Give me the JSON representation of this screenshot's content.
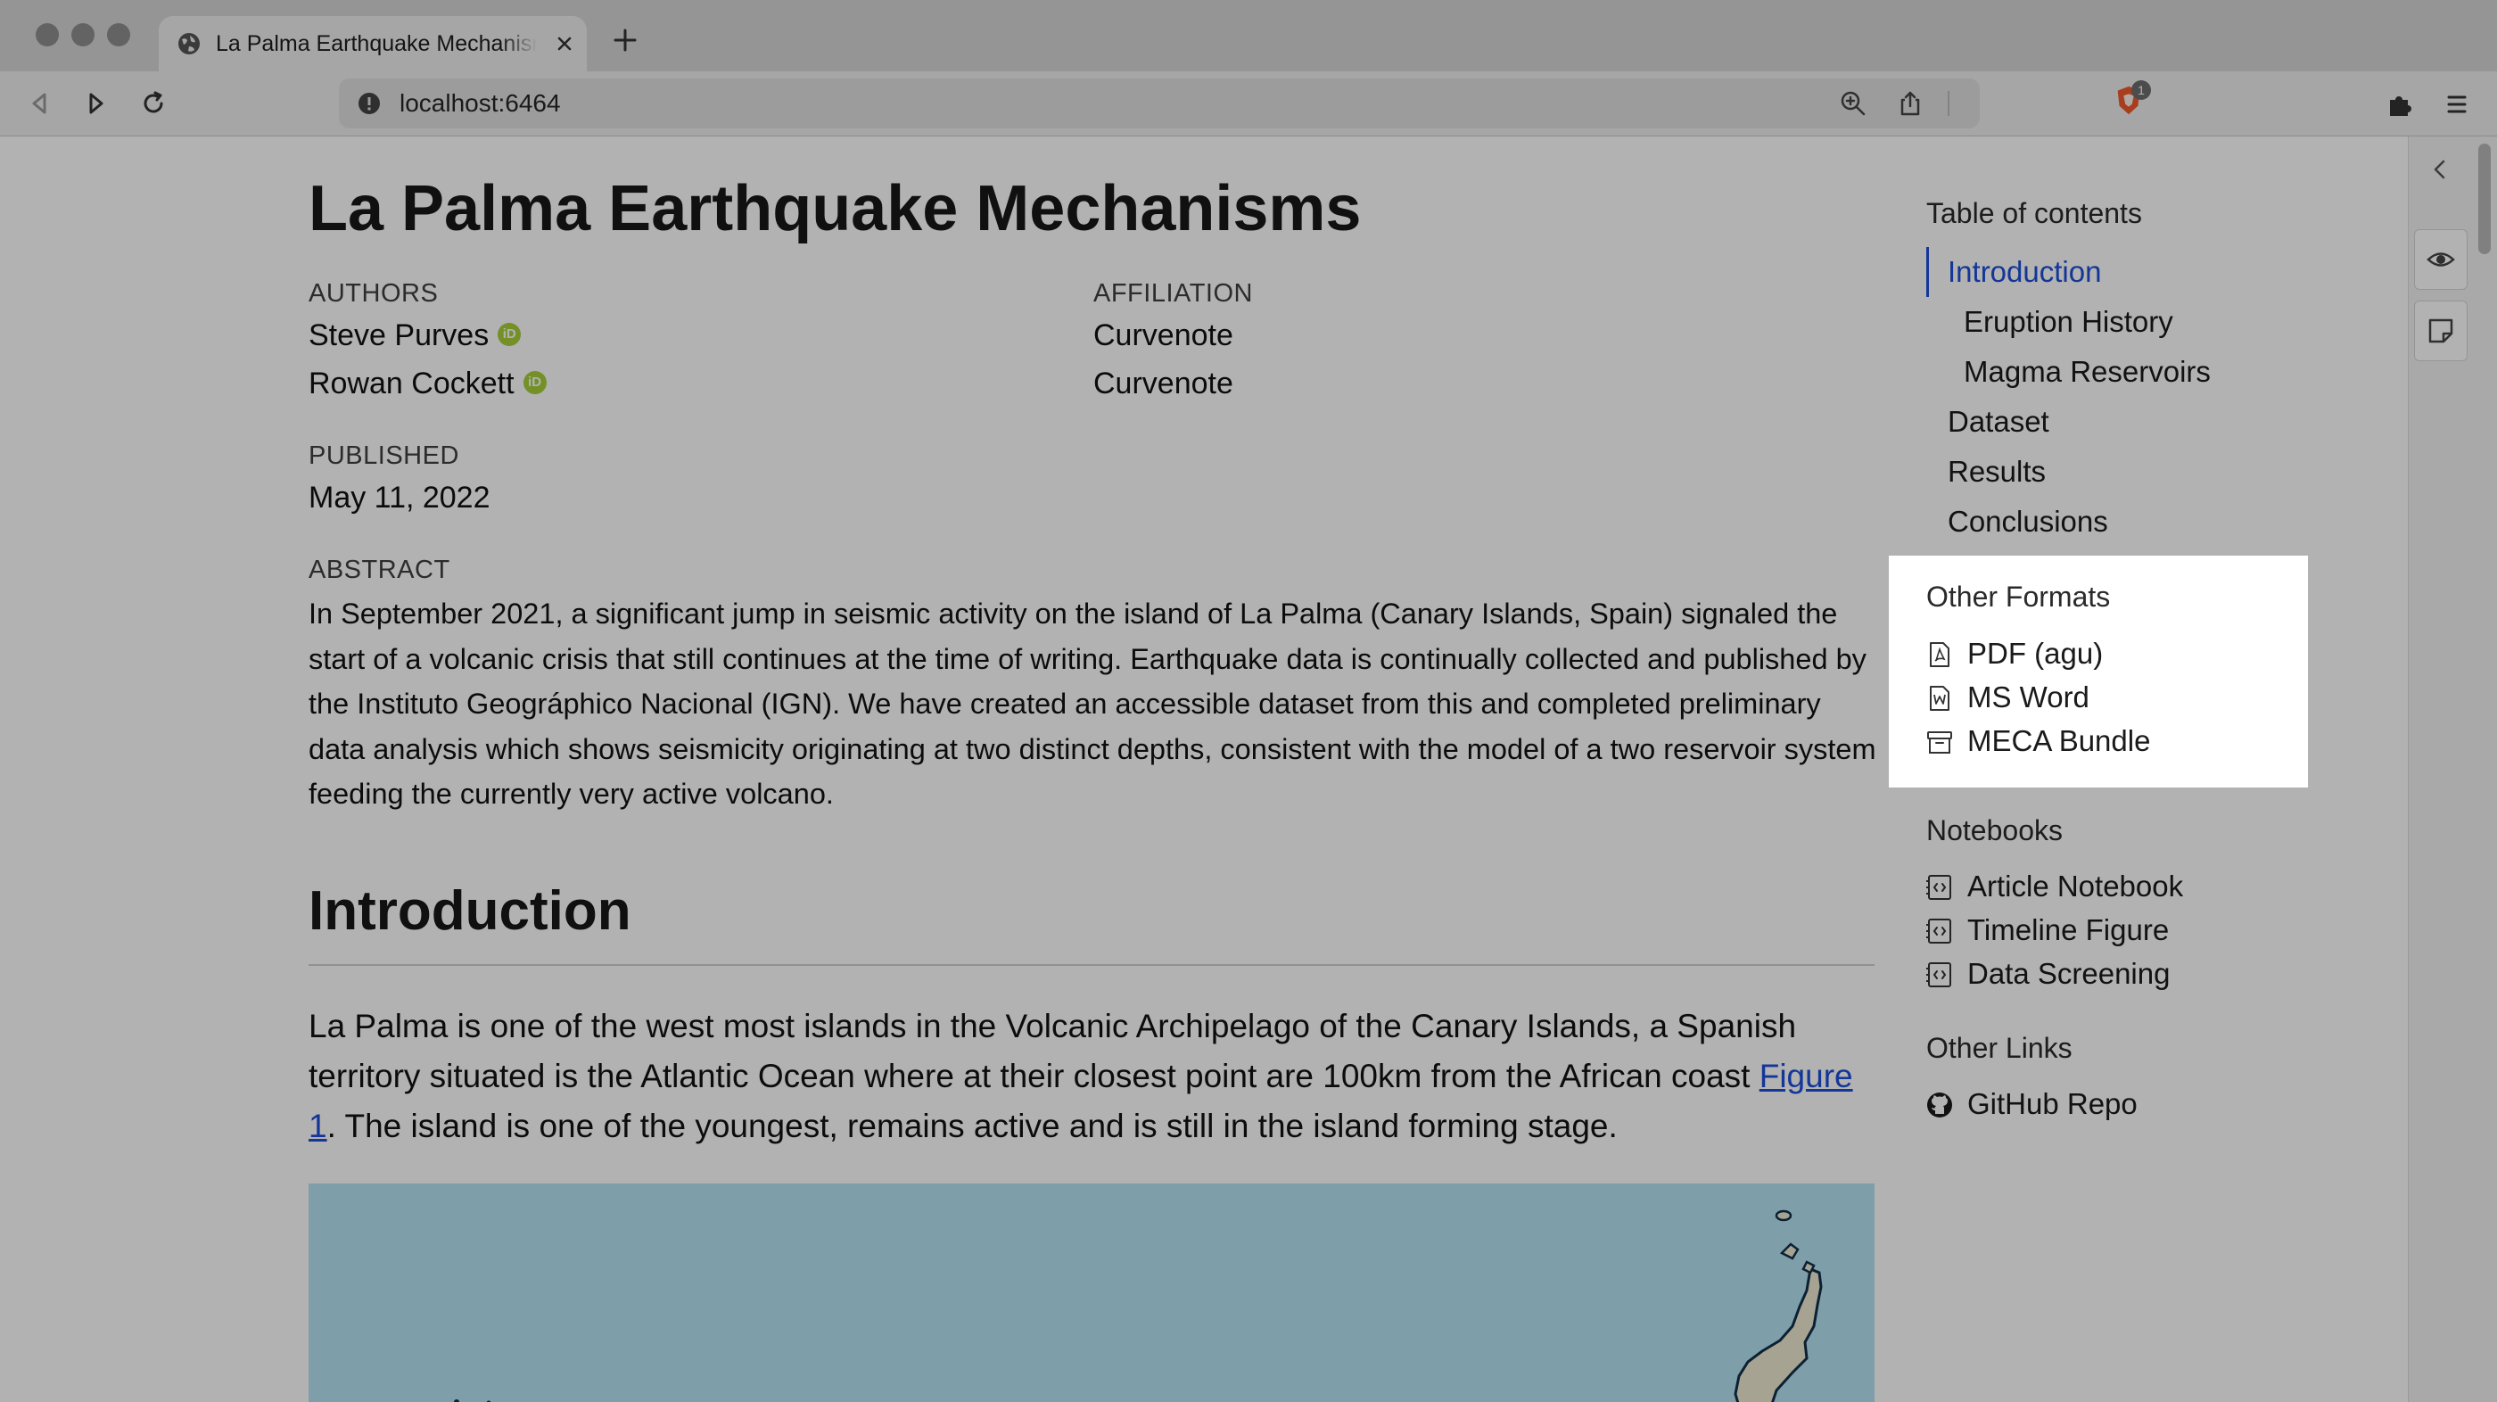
{
  "browser": {
    "tab_title": "La Palma Earthquake Mechanisms",
    "url": "localhost:6464",
    "brave_badge": "1"
  },
  "article": {
    "title": "La Palma Earthquake Mechanisms",
    "authors_label": "AUTHORS",
    "affiliation_label": "AFFILIATION",
    "authors": [
      {
        "name": "Steve Purves",
        "affiliation": "Curvenote"
      },
      {
        "name": "Rowan Cockett",
        "affiliation": "Curvenote"
      }
    ],
    "published_label": "PUBLISHED",
    "published_date": "May 11, 2022",
    "abstract_label": "ABSTRACT",
    "abstract": "In September 2021, a significant jump in seismic activity on the island of La Palma (Canary Islands, Spain) signaled the start of a volcanic crisis that still continues at the time of writing. Earthquake data is continually collected and published by the Instituto Geográphico Nacional (IGN). We have created an accessible dataset from this and completed preliminary data analysis which shows seismicity originating at two distinct depths, consistent with the model of a two reservoir system feeding the currently very active volcano.",
    "section_heading": "Introduction",
    "intro_text_before": "La Palma is one of the west most islands in the Volcanic Archipelago of the Canary Islands, a Spanish territory situated is the Atlantic Ocean where at their closest point are 100km from the African coast ",
    "intro_link": "Figure 1",
    "intro_text_after": ". The island is one of the youngest, remains active and is still in the island forming stage."
  },
  "sidebar": {
    "toc_heading": "Table of contents",
    "toc": [
      {
        "label": "Introduction",
        "level": 1,
        "active": true
      },
      {
        "label": "Eruption History",
        "level": 2
      },
      {
        "label": "Magma Reservoirs",
        "level": 2
      },
      {
        "label": "Dataset",
        "level": 1
      },
      {
        "label": "Results",
        "level": 1
      },
      {
        "label": "Conclusions",
        "level": 1
      }
    ],
    "formats_heading": "Other Formats",
    "formats": [
      {
        "label": "PDF (agu)",
        "icon": "pdf-file-icon"
      },
      {
        "label": "MS Word",
        "icon": "word-file-icon"
      },
      {
        "label": "MECA Bundle",
        "icon": "archive-icon"
      }
    ],
    "notebooks_heading": "Notebooks",
    "notebooks": [
      {
        "label": "Article Notebook",
        "icon": "notebook-icon"
      },
      {
        "label": "Timeline Figure",
        "icon": "notebook-icon"
      },
      {
        "label": "Data Screening",
        "icon": "notebook-icon"
      }
    ],
    "links_heading": "Other Links",
    "links": [
      {
        "label": "GitHub Repo",
        "icon": "github-icon"
      }
    ]
  },
  "colors": {
    "link": "#1d4ed8",
    "orcid": "#a6ce39",
    "map_water": "#b5e2f3",
    "map_land": "#f0ead2"
  }
}
